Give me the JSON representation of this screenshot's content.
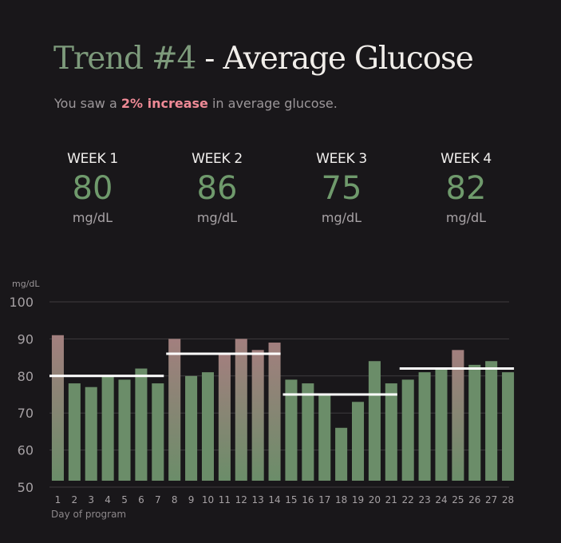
{
  "header": {
    "trend_label": "Trend #4",
    "title_rest": " - Average Glucose"
  },
  "summary": {
    "prefix": "You saw a ",
    "highlight": "2% increase",
    "suffix": " in average glucose."
  },
  "weeks": [
    {
      "label": "WEEK 1",
      "value": "80",
      "unit": "mg/dL"
    },
    {
      "label": "WEEK 2",
      "value": "86",
      "unit": "mg/dL"
    },
    {
      "label": "WEEK 3",
      "value": "75",
      "unit": "mg/dL"
    },
    {
      "label": "WEEK 4",
      "value": "82",
      "unit": "mg/dL"
    }
  ],
  "colors": {
    "background": "#19171a",
    "bar": "#6b8d69",
    "bar_high": "#a27f7e",
    "weekly_average_line": "#ffffff",
    "highlight": "#ef8a96"
  },
  "chart_data": {
    "type": "bar",
    "ylabel": "mg/dL",
    "xlabel": "Day of program",
    "ylim": [
      50,
      100
    ],
    "yticks": [
      50,
      60,
      70,
      80,
      90,
      100
    ],
    "grid": true,
    "categories": [
      "1",
      "2",
      "3",
      "4",
      "5",
      "6",
      "7",
      "8",
      "9",
      "10",
      "11",
      "12",
      "13",
      "14",
      "15",
      "16",
      "17",
      "18",
      "19",
      "20",
      "21",
      "22",
      "23",
      "24",
      "25",
      "26",
      "27",
      "28"
    ],
    "values": [
      91,
      78,
      77,
      80,
      79,
      82,
      78,
      90,
      80,
      81,
      86,
      90,
      87,
      89,
      79,
      78,
      75,
      66,
      73,
      84,
      78,
      79,
      81,
      82,
      87,
      83,
      84,
      81
    ],
    "weekly_averages": [
      {
        "start_day": 1,
        "end_day": 7,
        "value": 80
      },
      {
        "start_day": 8,
        "end_day": 14,
        "value": 86
      },
      {
        "start_day": 15,
        "end_day": 21,
        "value": 75
      },
      {
        "start_day": 22,
        "end_day": 28,
        "value": 82
      }
    ]
  }
}
